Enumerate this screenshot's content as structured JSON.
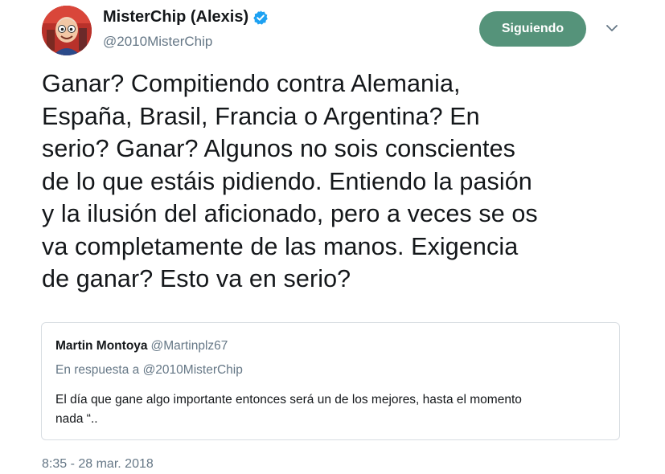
{
  "author": {
    "display_name": "MisterChip (Alexis)",
    "handle": "@2010MisterChip",
    "verified": true,
    "avatar_icon": "cartoon-avatar-icon"
  },
  "follow_button": {
    "label": "Siguiendo",
    "color": "#55937a"
  },
  "menu_icon": "chevron-down-icon",
  "tweet": {
    "text": "Ganar? Compitiendo contra Alemania,\nEspaña, Brasil, Francia o Argentina? En\nserio? Ganar? Algunos no sois conscientes\nde lo que estáis pidiendo. Entiendo la pasión\ny la ilusión del aficionado, pero a veces se os\nva completamente de las manos. Exigencia\nde ganar? Esto va en serio?",
    "timestamp": "8:35 - 28 mar. 2018"
  },
  "quoted_tweet": {
    "name": "Martin Montoya",
    "handle": "@Martinplz67",
    "reply_context": "En respuesta a @2010MisterChip",
    "text": "El día que gane algo importante entonces será un de los mejores, hasta el momento\nnada “.."
  },
  "colors": {
    "verified": "#1da1f2",
    "secondary_text": "#657786",
    "border": "#d8dde2"
  }
}
